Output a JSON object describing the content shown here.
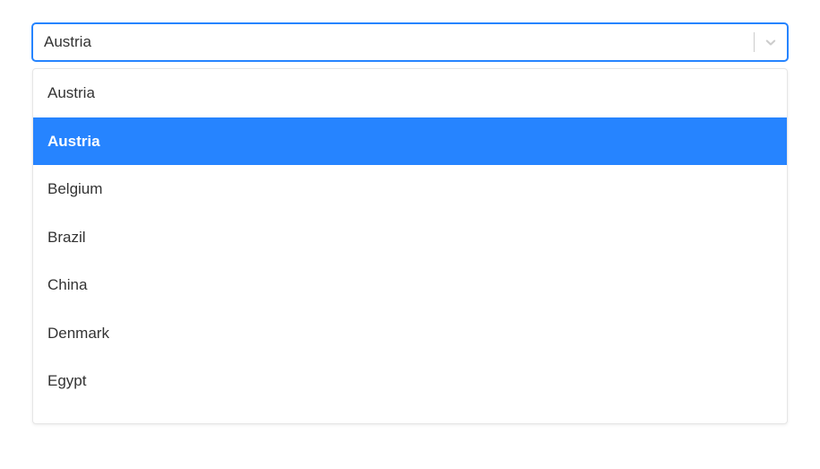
{
  "combobox": {
    "input_value": "Austria",
    "placeholder": "",
    "options": [
      {
        "label": "Austria",
        "highlighted": false
      },
      {
        "label": "Austria",
        "highlighted": true
      },
      {
        "label": "Belgium",
        "highlighted": false
      },
      {
        "label": "Brazil",
        "highlighted": false
      },
      {
        "label": "China",
        "highlighted": false
      },
      {
        "label": "Denmark",
        "highlighted": false
      },
      {
        "label": "Egypt",
        "highlighted": false
      }
    ],
    "colors": {
      "focus_border": "#2684ff",
      "highlight_bg": "#2684ff",
      "highlight_fg": "#ffffff"
    }
  }
}
